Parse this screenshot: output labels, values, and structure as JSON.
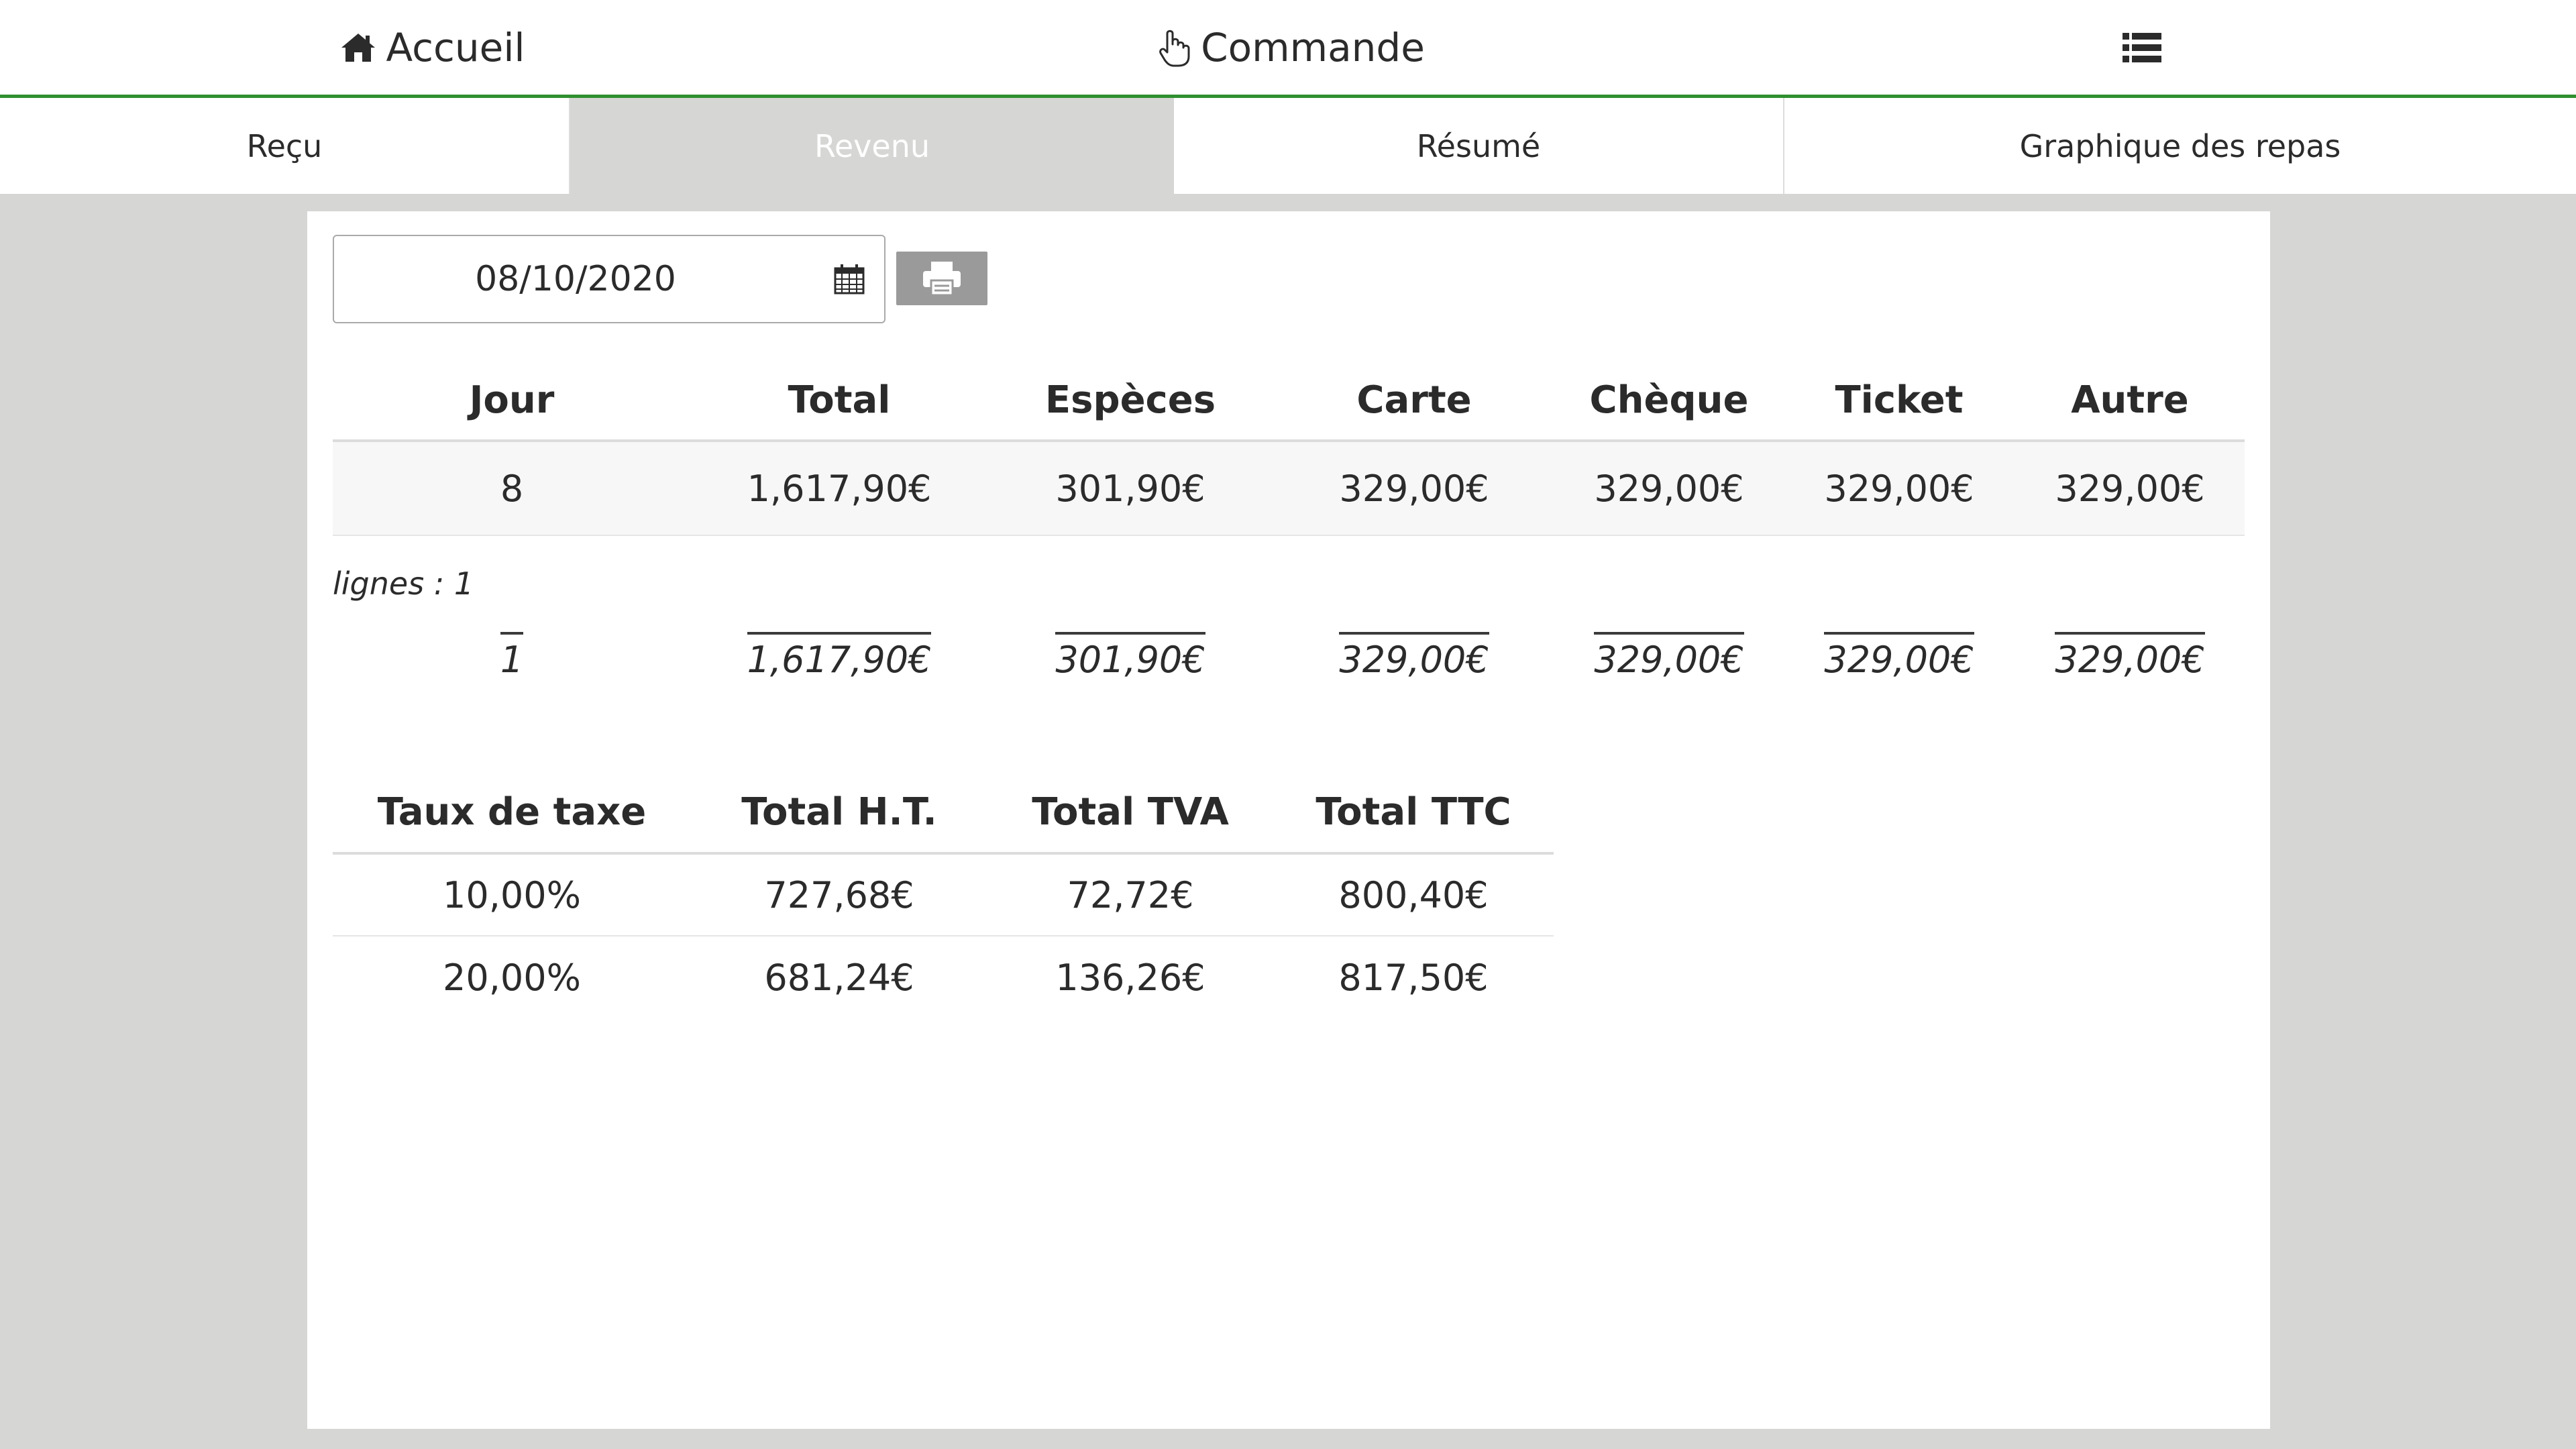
{
  "nav": {
    "home_label": "Accueil",
    "order_label": "Commande"
  },
  "tabs": [
    {
      "label": "Reçu"
    },
    {
      "label": "Revenu"
    },
    {
      "label": "Résumé"
    },
    {
      "label": "Graphique des repas"
    }
  ],
  "date_field": {
    "value": "08/10/2020"
  },
  "revenue_table": {
    "headers": [
      "Jour",
      "Total",
      "Espèces",
      "Carte",
      "Chèque",
      "Ticket",
      "Autre"
    ],
    "rows": [
      [
        "8",
        "1,617,90€",
        "301,90€",
        "329,00€",
        "329,00€",
        "329,00€",
        "329,00€"
      ]
    ],
    "row_count_label": "lignes : 1",
    "totals": [
      "1",
      "1,617,90€",
      "301,90€",
      "329,00€",
      "329,00€",
      "329,00€",
      "329,00€"
    ]
  },
  "tax_table": {
    "headers": [
      "Taux de taxe",
      "Total H.T.",
      "Total TVA",
      "Total TTC"
    ],
    "rows": [
      [
        "10,00%",
        "727,68€",
        "72,72€",
        "800,40€"
      ],
      [
        "20,00%",
        "681,24€",
        "136,26€",
        "817,50€"
      ]
    ]
  },
  "colors": {
    "accent_green": "#2f8f2f",
    "background_gray": "#d6d6d4",
    "print_button": "#9a9a9a"
  },
  "icons": {
    "home": "home-icon",
    "order": "pointer-hand-icon",
    "menu": "list-icon",
    "calendar": "calendar-icon",
    "print": "printer-icon"
  }
}
